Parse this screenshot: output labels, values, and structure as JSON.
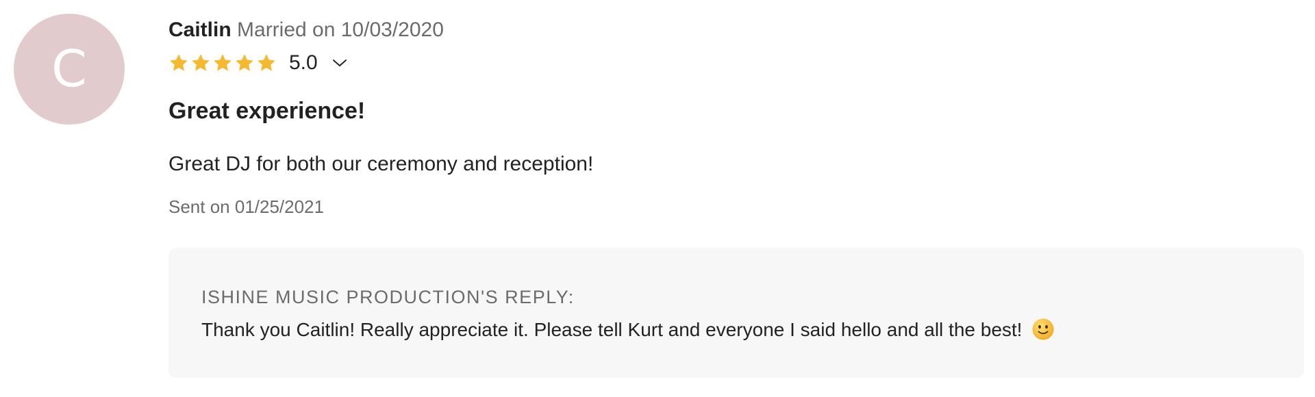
{
  "review": {
    "avatar_letter": "C",
    "author": "Caitlin",
    "married_text": "Married on 10/03/2020",
    "rating": {
      "stars_filled": 5,
      "stars_total": 5,
      "value": "5.0",
      "star_color": "#f5b82e"
    },
    "title": "Great experience!",
    "body": "Great DJ for both our ceremony and reception!",
    "sent": "Sent on 01/25/2021"
  },
  "reply": {
    "label": "ISHINE MUSIC PRODUCTION'S REPLY:",
    "text": "Thank you Caitlin! Really appreciate it. Please tell Kurt and everyone I said hello and all the best!",
    "emoji": "slightly-smiling-face"
  },
  "colors": {
    "avatar_bg": "#e2cbcd",
    "reply_bg": "#f7f7f7",
    "muted_text": "#6b6b6b",
    "primary_text": "#222222"
  }
}
